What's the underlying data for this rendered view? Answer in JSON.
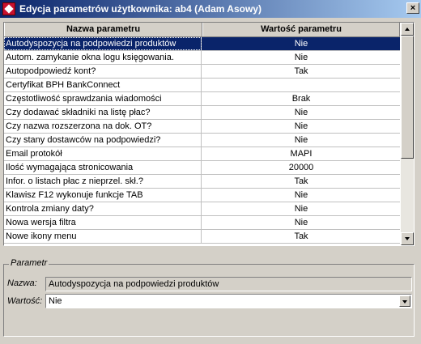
{
  "window": {
    "title": "Edycja parametrów użytkownika: ab4 (Adam Asowy)"
  },
  "grid": {
    "columns": [
      "Nazwa parametru",
      "Wartość parametru"
    ],
    "rows": [
      {
        "name": "Autodyspozycja na podpowiedzi produktów",
        "value": "Nie"
      },
      {
        "name": "Autom. zamykanie okna logu księgowania.",
        "value": "Nie"
      },
      {
        "name": "Autopodpowiedź kont?",
        "value": "Tak"
      },
      {
        "name": "Certyfikat BPH BankConnect",
        "value": ""
      },
      {
        "name": "Częstotliwość sprawdzania wiadomości",
        "value": "Brak"
      },
      {
        "name": "Czy dodawać składniki na listę płac?",
        "value": "Nie"
      },
      {
        "name": "Czy nazwa rozszerzona na dok. OT?",
        "value": "Nie"
      },
      {
        "name": "Czy stany dostawców na podpowiedzi?",
        "value": "Nie"
      },
      {
        "name": "Email protokół",
        "value": "MAPI"
      },
      {
        "name": "Ilość wymagająca stronicowania",
        "value": "20000"
      },
      {
        "name": "Infor. o listach płac z nieprzel. skł.?",
        "value": "Tak"
      },
      {
        "name": "Klawisz F12 wykonuje funkcje TAB",
        "value": "Nie"
      },
      {
        "name": "Kontrola zmiany daty?",
        "value": "Nie"
      },
      {
        "name": "Nowa wersja filtra",
        "value": "Nie"
      },
      {
        "name": "Nowe ikony menu",
        "value": "Tak"
      }
    ],
    "selected_index": 0
  },
  "param": {
    "legend": "Parametr",
    "name_label": "Nazwa:",
    "name_value": "Autodyspozycja na podpowiedzi produktów",
    "value_label": "Wartość:",
    "value_value": "Nie"
  }
}
